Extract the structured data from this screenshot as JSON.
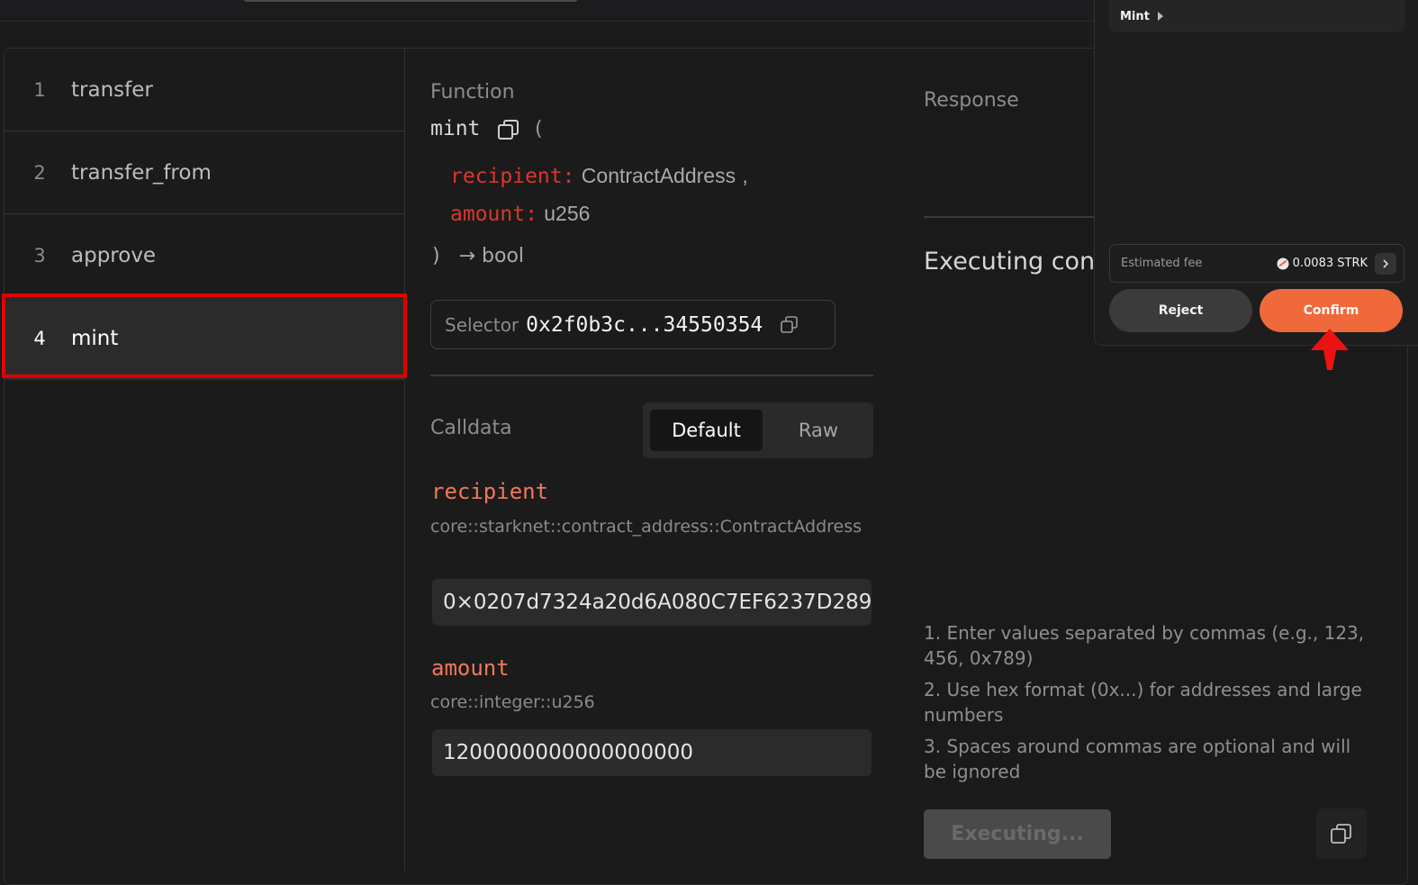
{
  "functions": [
    {
      "num": "1",
      "name": "transfer"
    },
    {
      "num": "2",
      "name": "transfer_from"
    },
    {
      "num": "3",
      "name": "approve"
    },
    {
      "num": "4",
      "name": "mint"
    }
  ],
  "function_panel": {
    "label": "Function",
    "name": "mint",
    "open_paren": "(",
    "params": [
      {
        "key": "recipient:",
        "type": "ContractAddress",
        "sep": ","
      },
      {
        "key": "amount:",
        "type": "u256",
        "sep": ""
      }
    ],
    "close": ")",
    "returns": "→ bool",
    "selector_label": "Selector",
    "selector_value": "0x2f0b3c...34550354"
  },
  "calldata": {
    "label": "Calldata",
    "mode_default": "Default",
    "mode_raw": "Raw",
    "fields": [
      {
        "name": "recipient",
        "type": "core::starknet::contract_address::ContractAddress",
        "value": "0×0207d7324a20d6A080C7EF6237D289"
      },
      {
        "name": "amount",
        "type": "core::integer::u256",
        "value": "1200000000000000000"
      }
    ]
  },
  "response": {
    "label": "Response",
    "executing_title": "Executing cont",
    "help": [
      "1. Enter values separated by commas (e.g., 123, 456, 0x789)",
      "2. Use hex format (0x...) for addresses and large numbers",
      "3. Spaces around commas are optional and will be ignored"
    ],
    "execute_button": "Executing..."
  },
  "wallet": {
    "title": "Mint",
    "fee_label": "Estimated fee",
    "fee_value": "0.0083 STRK",
    "reject": "Reject",
    "confirm": "Confirm"
  },
  "colors": {
    "accent": "#f0693a",
    "param_key": "#d9372b",
    "field_name": "#f0785a",
    "highlight": "#e00000"
  }
}
